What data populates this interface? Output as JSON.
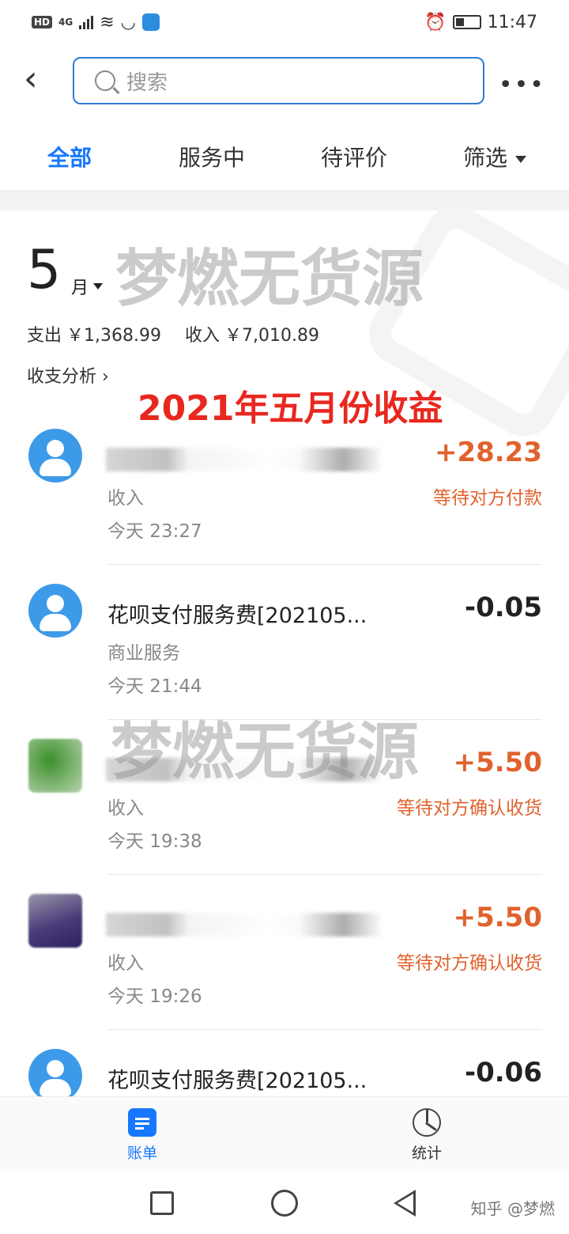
{
  "status_bar": {
    "network_badge": "HD",
    "signal": "4G",
    "time": "11:47"
  },
  "header": {
    "back_icon": "chevron-left-icon",
    "search_placeholder": "搜索",
    "more_icon": "more-dots-icon"
  },
  "tabs": [
    {
      "label": "全部",
      "active": true
    },
    {
      "label": "服务中",
      "active": false
    },
    {
      "label": "待评价",
      "active": false
    },
    {
      "label": "筛选",
      "active": false
    }
  ],
  "summary": {
    "month_number": "5",
    "month_unit": "月",
    "expense_label": "支出",
    "expense_value": "￥1,368.99",
    "income_label": "收入",
    "income_value": "￥7,010.89",
    "analysis_link": "收支分析 ›",
    "watermark_text": "梦燃无货源",
    "banner_text": "2021年五月份收益"
  },
  "transactions": [
    {
      "title": "",
      "title_blurred": true,
      "category": "收入",
      "time": "今天  23:27",
      "amount": "+28.23",
      "amount_kind": "plus",
      "status": "等待对方付款",
      "avatar": "default"
    },
    {
      "title": "花呗支付服务费[202105...",
      "title_blurred": false,
      "category": "商业服务",
      "time": "今天  21:44",
      "amount": "-0.05",
      "amount_kind": "minus",
      "status": "",
      "avatar": "default"
    },
    {
      "title": "",
      "title_blurred": true,
      "category": "收入",
      "time": "今天  19:38",
      "amount": "+5.50",
      "amount_kind": "plus",
      "status": "等待对方确认收货",
      "avatar": "blur-green"
    },
    {
      "title": "",
      "title_blurred": true,
      "category": "收入",
      "time": "今天  19:26",
      "amount": "+5.50",
      "amount_kind": "plus",
      "status": "等待对方确认收货",
      "avatar": "blur-purple"
    },
    {
      "title": "花呗支付服务费[202105...",
      "title_blurred": false,
      "category": "",
      "time": "",
      "amount": "-0.06",
      "amount_kind": "minus",
      "status": "",
      "avatar": "default"
    }
  ],
  "bottom_nav": {
    "bill_label": "账单",
    "stats_label": "统计"
  },
  "system_nav": {
    "credit": "知乎 @梦燃"
  },
  "colors": {
    "accent_blue": "#1677ff",
    "amount_orange": "#e0622d",
    "banner_red": "#e8281f"
  }
}
